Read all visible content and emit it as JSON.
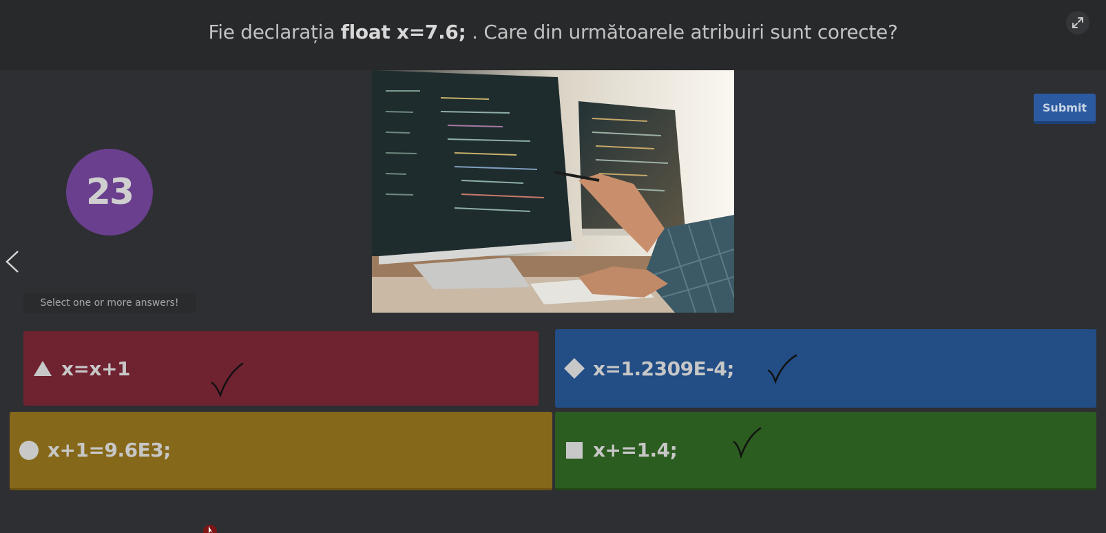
{
  "header": {
    "question_prefix": "Fie declarația ",
    "question_bold": "float x=7.6;",
    "question_suffix": " . Care din următoarele atribuiri sunt corecte?"
  },
  "icons": {
    "fullscreen": "expand-icon",
    "back": "chevron-left-icon",
    "triangle": "triangle-icon",
    "diamond": "diamond-icon",
    "circle": "circle-icon",
    "square": "square-icon"
  },
  "submit_label": "Submit",
  "question_number": "23",
  "hint": "Select one or more answers!",
  "answers": [
    {
      "shape": "triangle",
      "text": "x=x+1",
      "color": "#6f2230",
      "marked": true
    },
    {
      "shape": "diamond",
      "text": "x=1.2309E-4;",
      "color": "#224d85",
      "marked": true
    },
    {
      "shape": "circle",
      "text": "x+1=9.6E3;",
      "color": "#86681a",
      "marked": false
    },
    {
      "shape": "square",
      "text": "x+=1.4;",
      "color": "#2b5c20",
      "marked": true
    }
  ],
  "colors": {
    "background": "#2e2f32",
    "header": "#28292b",
    "submit": "#2b5aa0",
    "question_badge": "#6a3f8e"
  }
}
